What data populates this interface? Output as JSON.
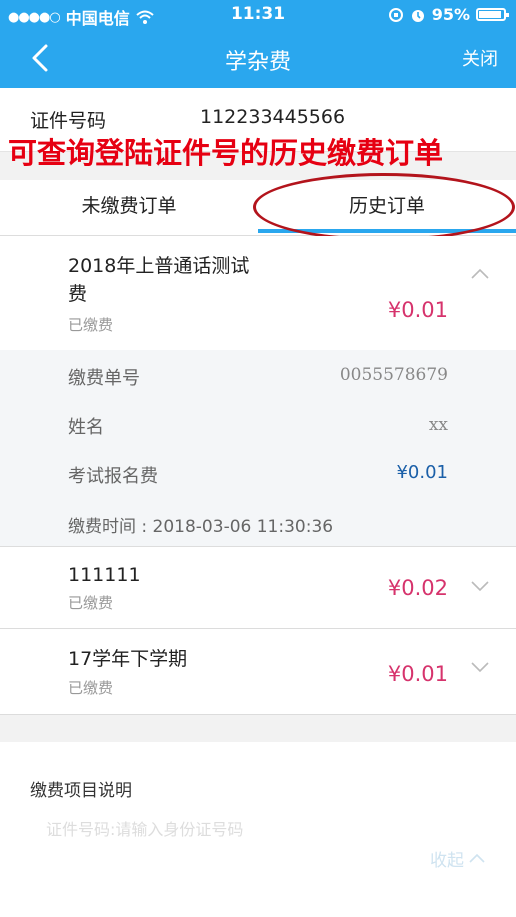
{
  "status_bar": {
    "signal_dots": "●●●●○",
    "carrier": "中国电信",
    "time": "11:31",
    "battery": "95%"
  },
  "nav": {
    "title": "学杂费",
    "close": "关闭"
  },
  "id_row": {
    "label": "证件号码",
    "value": "112233445566"
  },
  "annotation": "可查询登陆证件号的历史缴费订单",
  "tabs": [
    {
      "label": "未缴费订单"
    },
    {
      "label": "历史订单"
    }
  ],
  "orders": [
    {
      "name": "2018年上普通话测试费",
      "status": "已缴费",
      "amount": "¥0.01",
      "details": {
        "order_no_label": "缴费单号",
        "order_no": "0055578679",
        "name_label": "姓名",
        "name_value": "xx",
        "fee_label": "考试报名费",
        "fee_value": "¥0.01",
        "time_text": "缴费时间 : 2018-03-06 11:30:36"
      }
    },
    {
      "name": "111111",
      "status": "已缴费",
      "amount": "¥0.02"
    },
    {
      "name": "17学年下学期",
      "status": "已缴费",
      "amount": "¥0.01"
    }
  ],
  "info": {
    "title": "缴费项目说明",
    "line": "证件号码:请输入身份证号码",
    "collapse": "收起"
  },
  "colors": {
    "accent": "#2aa7ee",
    "amount": "#d6336c",
    "annotation": "#e60012"
  }
}
